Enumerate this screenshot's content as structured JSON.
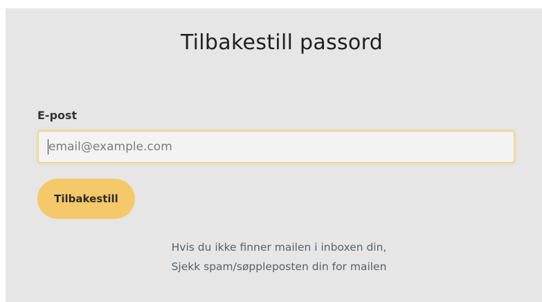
{
  "page": {
    "title": "Tilbakestill passord"
  },
  "form": {
    "email_label": "E-post",
    "email_value": "",
    "email_placeholder": "email@example.com",
    "submit_label": "Tilbakestill"
  },
  "help": {
    "line1": "Hvis du ikke finner mailen i inboxen din,",
    "line2": "Sjekk spam/søppleposten din for mailen"
  },
  "colors": {
    "background": "#e6e6e6",
    "accent": "#f5c96a",
    "focus_border": "#f5cf73",
    "text": "#1f1f1f",
    "muted_text": "#56606a"
  }
}
